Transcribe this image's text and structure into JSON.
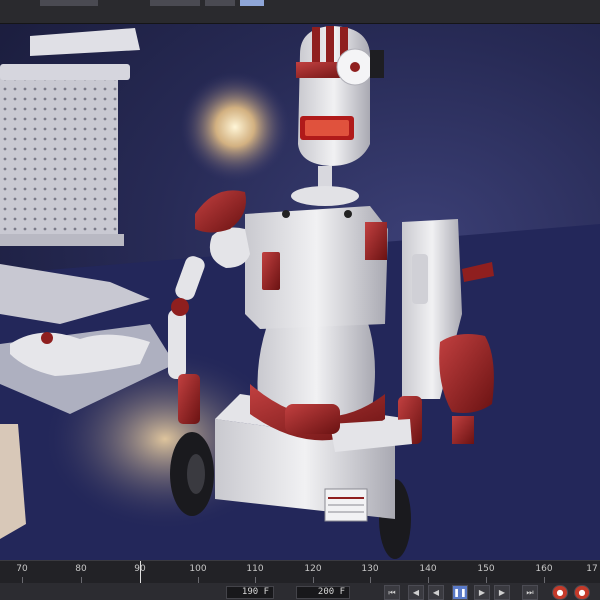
{
  "window": {
    "active_tab_color": "#8fa6d8"
  },
  "viewport": {
    "scene": "robot"
  },
  "timeline": {
    "ticks": [
      "70",
      "80",
      "90",
      "100",
      "110",
      "120",
      "130",
      "140",
      "150",
      "160",
      "17"
    ],
    "playhead_frame": 90,
    "current_frame": "190 F",
    "end_frame": "200 F"
  },
  "transport": {
    "icons": [
      "go-to-start-icon",
      "step-back-icon",
      "play-backward-icon",
      "pause-icon",
      "play-forward-icon",
      "step-forward-icon",
      "go-to-end-icon",
      "record-key-icon",
      "auto-key-icon"
    ]
  },
  "colors": {
    "accent": "#5a7ac8",
    "record": "#c43a2a",
    "robot_red": "#8f1f1f",
    "robot_white": "#e8e8ea"
  }
}
